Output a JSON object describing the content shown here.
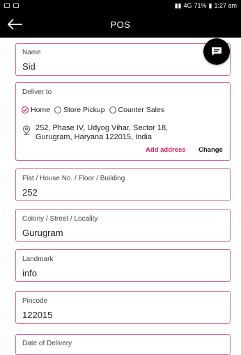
{
  "status_bar": {
    "battery": "71%",
    "time": "1:27 am",
    "signal_text": "4G"
  },
  "app_bar": {
    "title": "POS"
  },
  "form": {
    "name": {
      "label": "Name",
      "value": "Sid"
    },
    "deliver_to": {
      "label": "Deliver to",
      "options": [
        "Home",
        "Store Pickup",
        "Counter Sales"
      ],
      "selected": "Home",
      "address_line1": "252, Phase IV, Udyog Vihar, Sector 18,",
      "address_line2": "Gurugram, Haryana 122015, India",
      "add_address": "Add address",
      "change": "Change"
    },
    "flat": {
      "label": "Flat / House No. / Floor / Building",
      "value": "252"
    },
    "colony": {
      "label": "Colony / Street / Locality",
      "value": "Gurugram"
    },
    "landmark": {
      "label": "Landmark",
      "value": "info"
    },
    "pincode": {
      "label": "Pincode",
      "value": "122015"
    },
    "delivery_date": {
      "label": "Date of Delivery"
    }
  },
  "colors": {
    "accent": "#d81b60",
    "card_border": "#d4699d",
    "bar": "#000000"
  },
  "icons": {
    "back": "arrow-left-icon",
    "chat": "chat-icon",
    "pin": "location-pin-icon"
  }
}
